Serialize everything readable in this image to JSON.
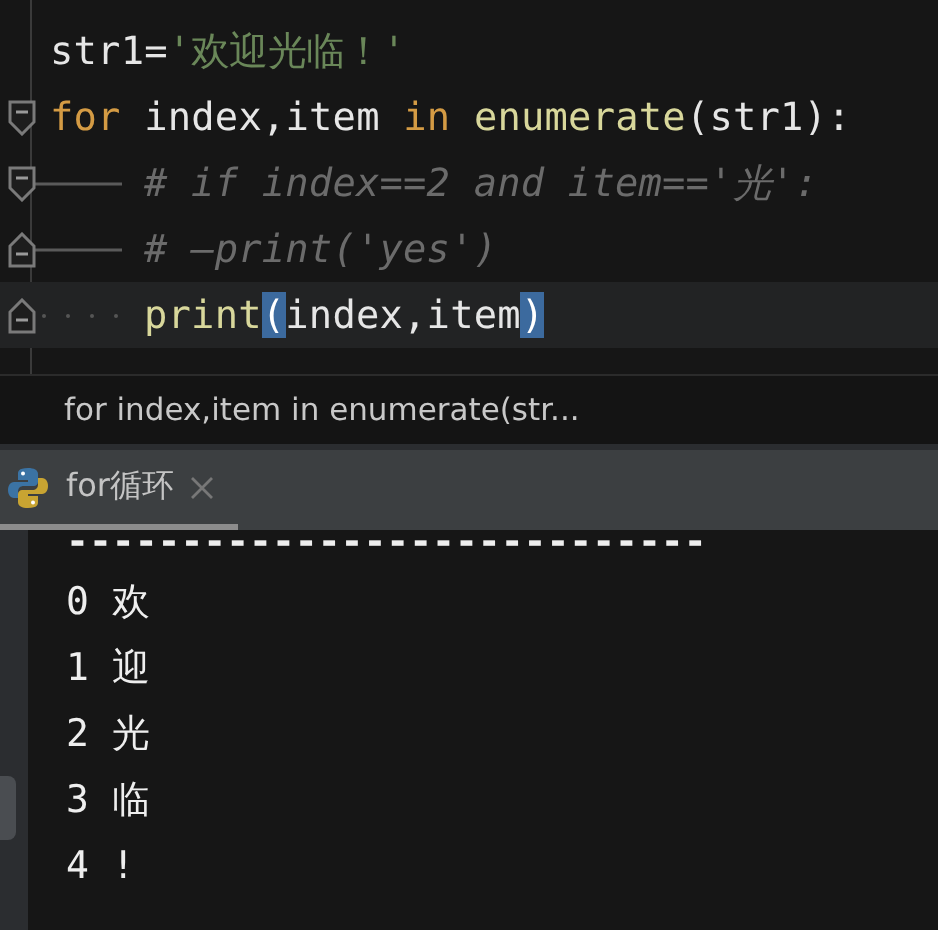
{
  "editor": {
    "lines": [
      {
        "fold_open": false,
        "fold_close": false,
        "indent_tab": false,
        "indent_spaces": false,
        "current": false,
        "tokens": [
          {
            "kind": "plain",
            "text": "str1="
          },
          {
            "kind": "string",
            "text": "'欢迎光临！'"
          }
        ]
      },
      {
        "fold_open": true,
        "fold_close": false,
        "indent_tab": false,
        "indent_spaces": false,
        "current": false,
        "tokens": [
          {
            "kind": "keyword",
            "text": "for"
          },
          {
            "kind": "plain",
            "text": " index,item "
          },
          {
            "kind": "keyword",
            "text": "in"
          },
          {
            "kind": "builtin",
            "text": " enumerate"
          },
          {
            "kind": "plain",
            "text": "(str1):"
          }
        ]
      },
      {
        "fold_open": true,
        "fold_close": false,
        "indent_tab": true,
        "indent_spaces": false,
        "current": false,
        "tokens": [
          {
            "kind": "comment",
            "text": "# if index==2 and item=='光':"
          }
        ]
      },
      {
        "fold_open": false,
        "fold_close": true,
        "indent_tab": true,
        "indent_spaces": false,
        "current": false,
        "tokens": [
          {
            "kind": "comment",
            "text": "# —print('yes')"
          }
        ]
      },
      {
        "fold_open": false,
        "fold_close": true,
        "indent_tab": false,
        "indent_spaces": true,
        "current": true,
        "tokens": [
          {
            "kind": "builtin",
            "text": "print"
          },
          {
            "kind": "match",
            "text": "("
          },
          {
            "kind": "plain",
            "text": "index,item"
          },
          {
            "kind": "match",
            "text": ")"
          }
        ]
      }
    ]
  },
  "breadcrumb": "for index,item in enumerate(str...",
  "run_tab": {
    "label": "for循环",
    "selected": true
  },
  "console": {
    "lines": [
      "----------------------------",
      "0 欢",
      "1 迎",
      "2 光",
      "3 临",
      "4 !"
    ]
  }
}
